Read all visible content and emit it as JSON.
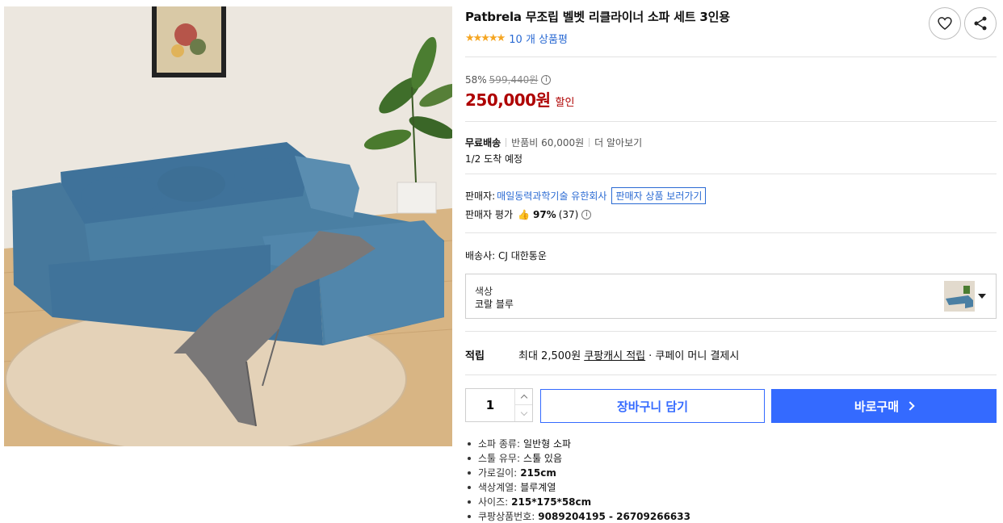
{
  "product": {
    "title": "Patbrela 무조립 벨벳 리클라이너 소파 세트 3인용",
    "stars": "★★★★★",
    "review_count": "10 개 상품평",
    "rating_fraction": 1.0
  },
  "price": {
    "discount_rate": "58%",
    "original": "599,440원",
    "info_glyph": "i",
    "sale": "250,000원",
    "sale_label": "할인"
  },
  "shipping": {
    "free": "무료배송",
    "return_fee": "반품비 60,000원",
    "more": "더 알아보기",
    "arrival": "1/2 도착 예정"
  },
  "seller": {
    "label": "판매자:",
    "name": "매일동력과학기술 유한회사",
    "view_button": "판매자 상품 보러가기",
    "rating_label": "판매자 평가",
    "rating_pct": "97%",
    "rating_count": "(37)",
    "thumb_glyph": "👍",
    "info_glyph": "i"
  },
  "carrier": {
    "text": "배송사:  CJ 대한통운"
  },
  "option": {
    "label": "색상",
    "value": "코랄 블루"
  },
  "points": {
    "title": "적립",
    "prefix": "최대 2,500원",
    "link": "쿠팡캐시 적립",
    "suffix": "· 쿠페이 머니 결제시"
  },
  "purchase": {
    "quantity": "1",
    "cart_label": "장바구니 담기",
    "buy_label": "바로구매"
  },
  "attributes": [
    {
      "key": "소파 종류:",
      "value": "일반형 소파",
      "bold": false
    },
    {
      "key": "스툴 유무:",
      "value": "스툴 있음",
      "bold": false
    },
    {
      "key": "가로길이:",
      "value": "215cm",
      "bold": true
    },
    {
      "key": "색상계열:",
      "value": "블루계열",
      "bold": false
    },
    {
      "key": "사이즈:",
      "value": "215*175*58cm",
      "bold": true
    },
    {
      "key": "쿠팡상품번호:",
      "value": "9089204195 - 26709266633",
      "bold": true
    }
  ],
  "colors": {
    "accent": "#346aff",
    "price_red": "#ae0000",
    "link_blue": "#2a6ad3",
    "star": "#f5a623",
    "sofa": "#4a7fa3"
  },
  "icons": {
    "wishlist": "heart-icon",
    "share": "share-icon"
  }
}
